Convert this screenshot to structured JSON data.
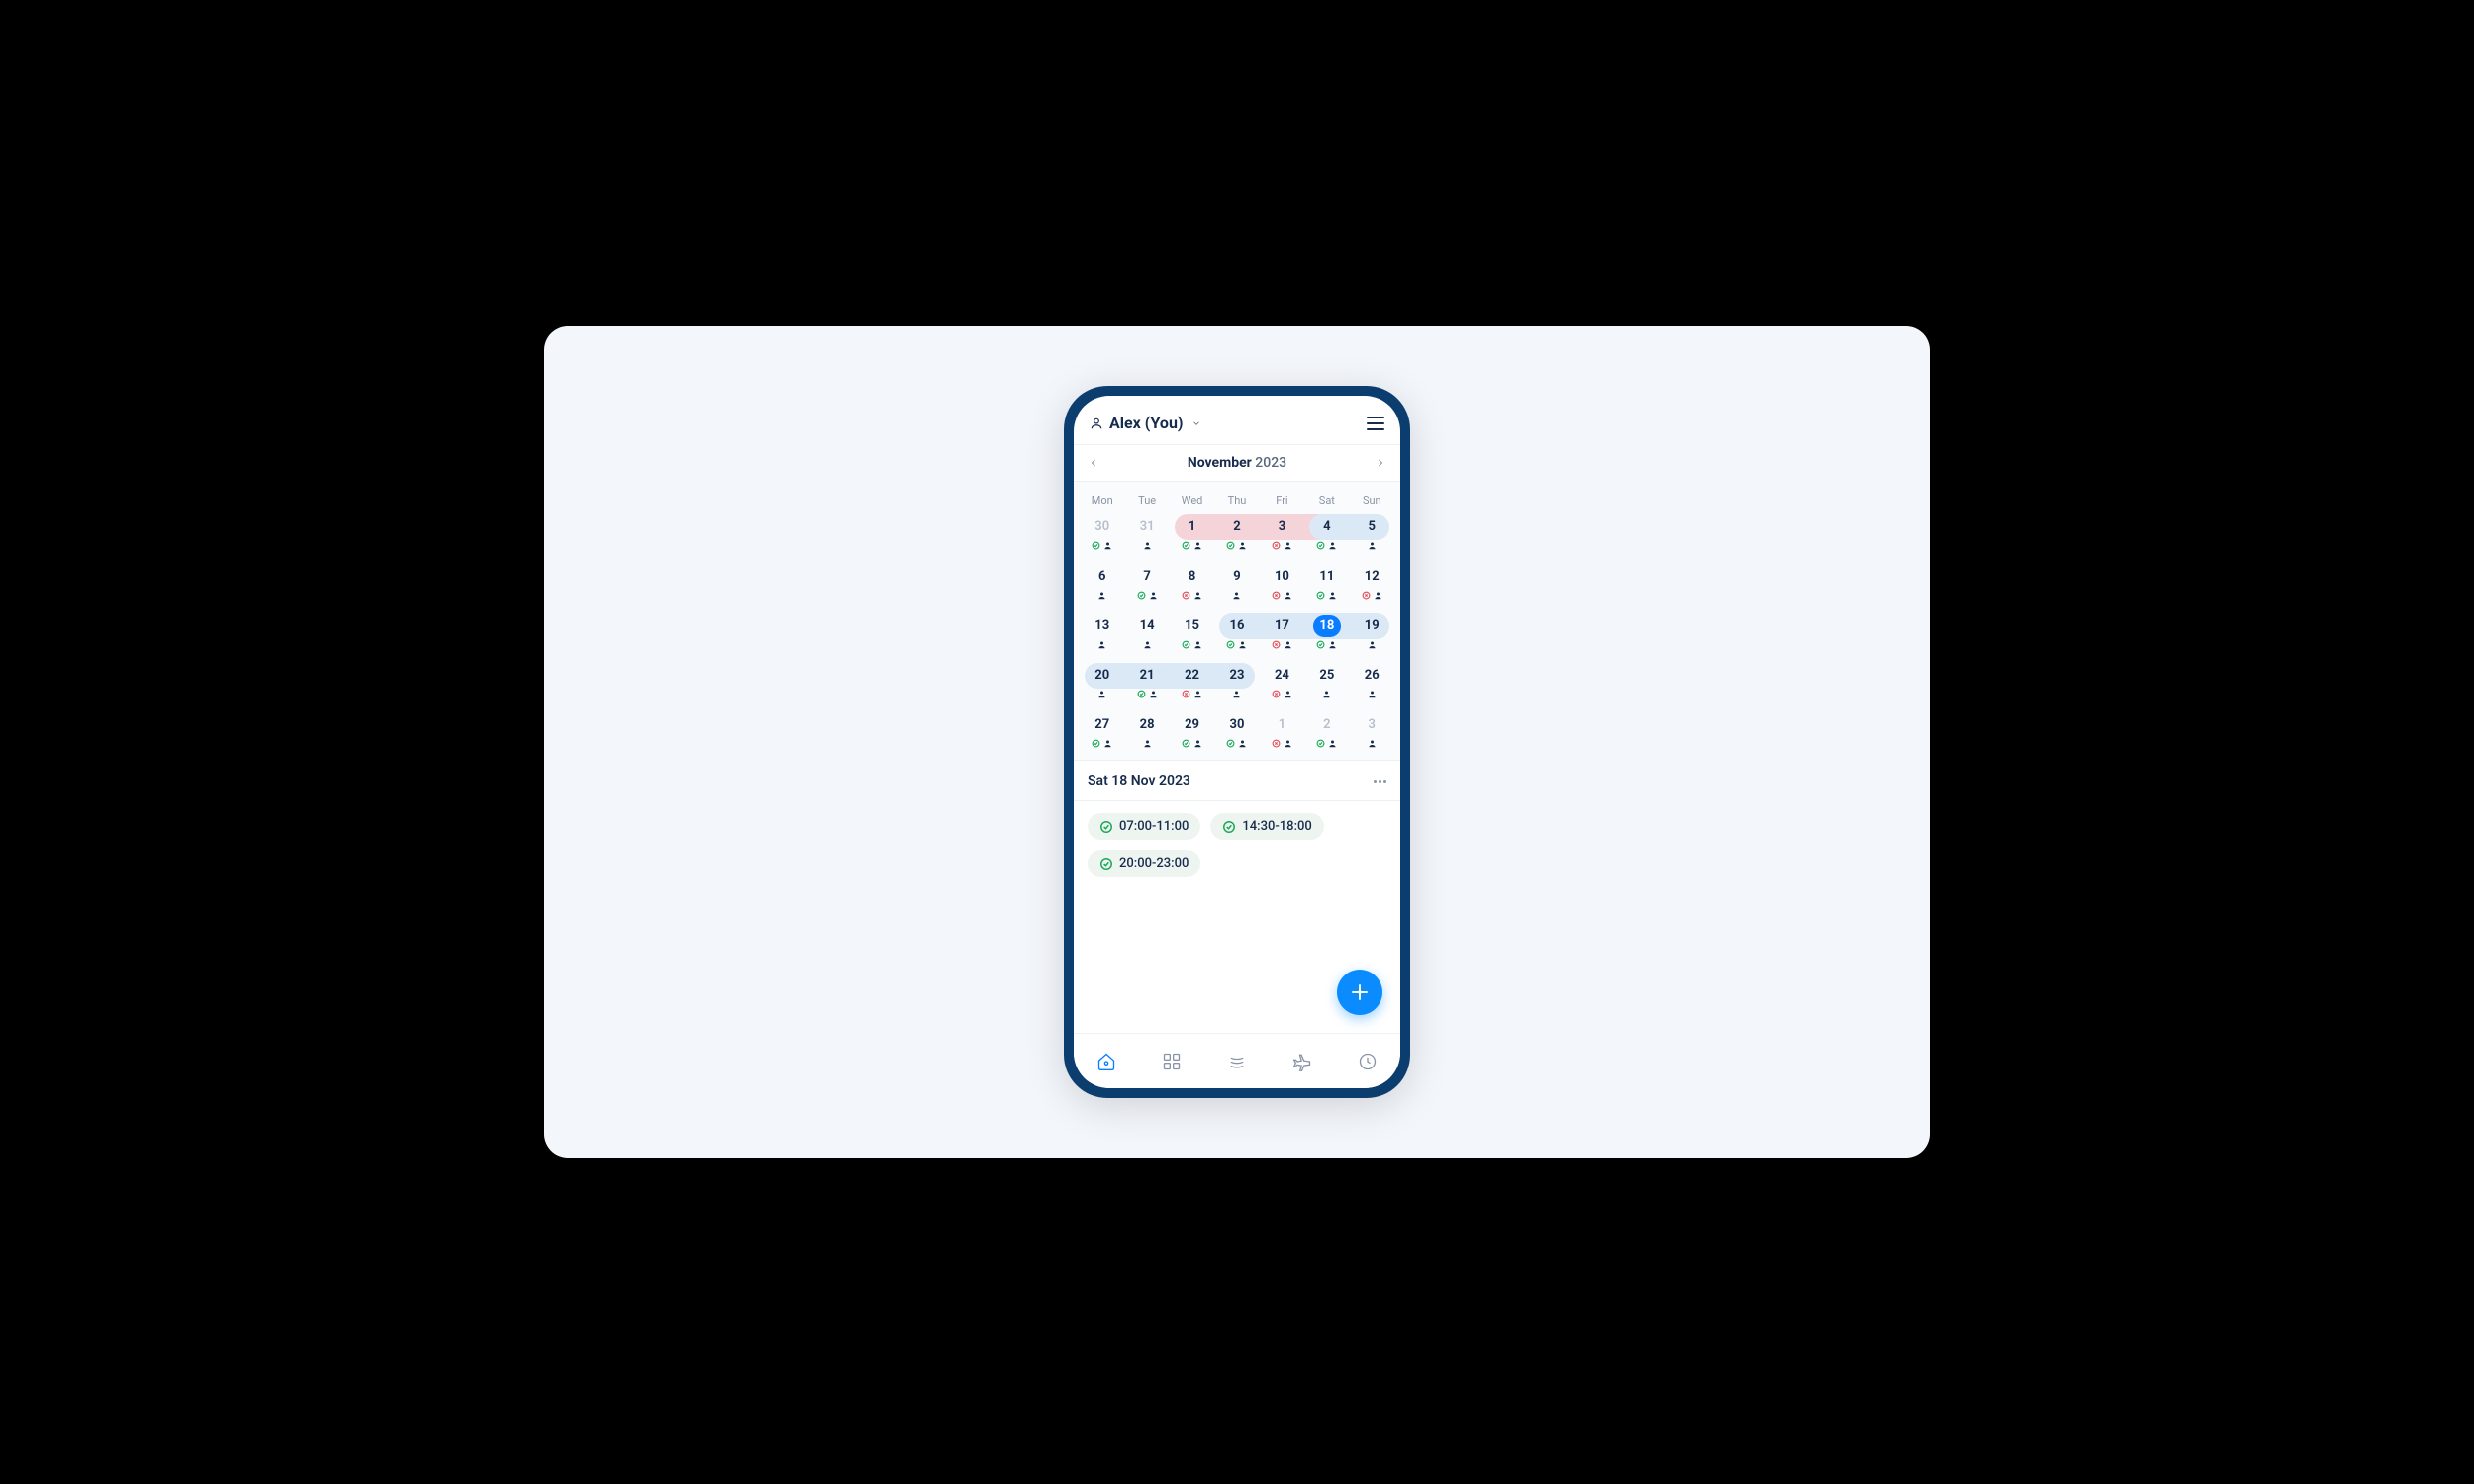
{
  "header": {
    "user_label": "Alex (You)"
  },
  "calendar": {
    "month": "November",
    "year": "2023",
    "dow": [
      "Mon",
      "Tue",
      "Wed",
      "Thu",
      "Fri",
      "Sat",
      "Sun"
    ],
    "weeks": [
      {
        "pills": [
          {
            "kind": "pink",
            "start": 2,
            "end": 5
          },
          {
            "kind": "blue",
            "start": 5,
            "end": 6
          }
        ],
        "days": [
          {
            "n": "30",
            "muted": true,
            "marks": [
              "check",
              "person"
            ]
          },
          {
            "n": "31",
            "muted": true,
            "marks": [
              "person"
            ]
          },
          {
            "n": "1",
            "marks": [
              "check",
              "person"
            ]
          },
          {
            "n": "2",
            "marks": [
              "check",
              "person"
            ]
          },
          {
            "n": "3",
            "marks": [
              "x",
              "person"
            ]
          },
          {
            "n": "4",
            "marks": [
              "check",
              "person"
            ]
          },
          {
            "n": "5",
            "marks": [
              "person"
            ]
          }
        ]
      },
      {
        "pills": [],
        "days": [
          {
            "n": "6",
            "marks": [
              "person"
            ]
          },
          {
            "n": "7",
            "marks": [
              "check",
              "person"
            ]
          },
          {
            "n": "8",
            "marks": [
              "x",
              "person"
            ]
          },
          {
            "n": "9",
            "marks": [
              "person"
            ]
          },
          {
            "n": "10",
            "marks": [
              "x",
              "person"
            ]
          },
          {
            "n": "11",
            "marks": [
              "check",
              "person"
            ]
          },
          {
            "n": "12",
            "marks": [
              "x",
              "person"
            ]
          }
        ]
      },
      {
        "pills": [
          {
            "kind": "blue",
            "start": 3,
            "end": 6
          }
        ],
        "days": [
          {
            "n": "13",
            "marks": [
              "person"
            ]
          },
          {
            "n": "14",
            "marks": [
              "person"
            ]
          },
          {
            "n": "15",
            "marks": [
              "check",
              "person"
            ]
          },
          {
            "n": "16",
            "marks": [
              "check",
              "person"
            ]
          },
          {
            "n": "17",
            "marks": [
              "x",
              "person"
            ]
          },
          {
            "n": "18",
            "selected": true,
            "marks": [
              "check",
              "person"
            ]
          },
          {
            "n": "19",
            "marks": [
              "person"
            ]
          }
        ]
      },
      {
        "pills": [
          {
            "kind": "blue",
            "start": 0,
            "end": 3
          }
        ],
        "days": [
          {
            "n": "20",
            "marks": [
              "person"
            ]
          },
          {
            "n": "21",
            "marks": [
              "check",
              "person"
            ]
          },
          {
            "n": "22",
            "marks": [
              "x",
              "person"
            ]
          },
          {
            "n": "23",
            "marks": [
              "person"
            ]
          },
          {
            "n": "24",
            "marks": [
              "x",
              "person"
            ]
          },
          {
            "n": "25",
            "marks": [
              "person"
            ]
          },
          {
            "n": "26",
            "marks": [
              "person"
            ]
          }
        ]
      },
      {
        "pills": [],
        "days": [
          {
            "n": "27",
            "marks": [
              "check",
              "person"
            ]
          },
          {
            "n": "28",
            "marks": [
              "person"
            ]
          },
          {
            "n": "29",
            "marks": [
              "check",
              "person"
            ]
          },
          {
            "n": "30",
            "marks": [
              "check",
              "person"
            ]
          },
          {
            "n": "1",
            "muted": true,
            "marks": [
              "x",
              "person"
            ]
          },
          {
            "n": "2",
            "muted": true,
            "marks": [
              "check",
              "person"
            ]
          },
          {
            "n": "3",
            "muted": true,
            "marks": [
              "person"
            ]
          }
        ]
      }
    ]
  },
  "selected": {
    "title": "Sat 18 Nov 2023",
    "slots": [
      "07:00-11:00",
      "14:30-18:00",
      "20:00-23:00"
    ]
  },
  "tabs": [
    "home",
    "grid",
    "queue",
    "plane",
    "clock"
  ]
}
